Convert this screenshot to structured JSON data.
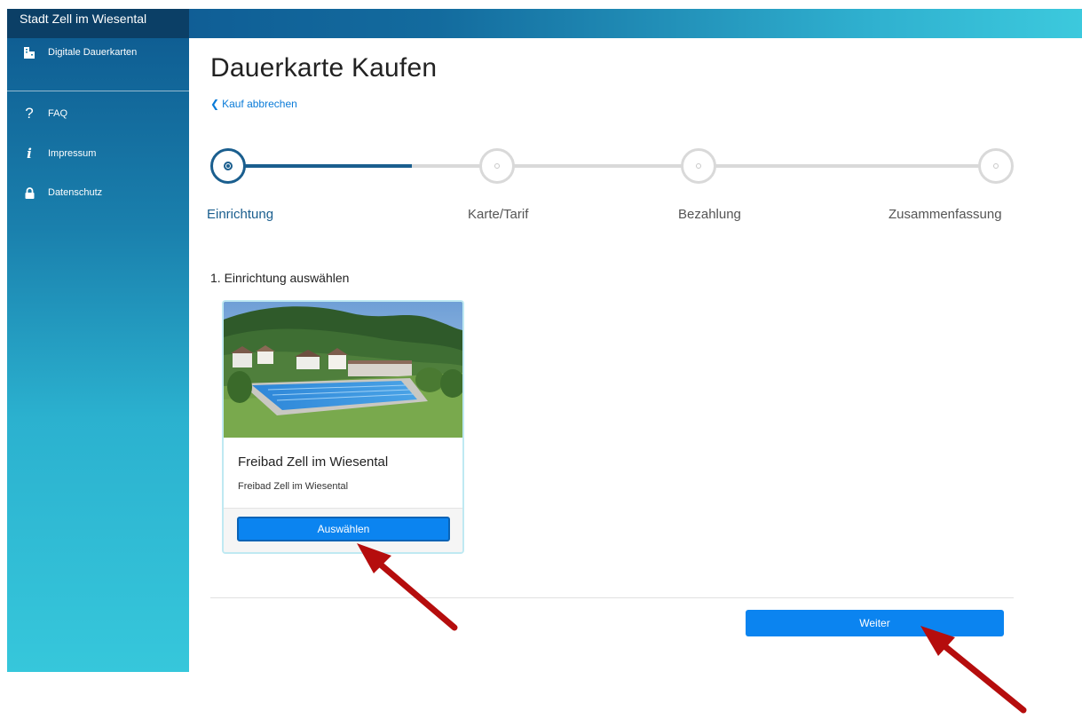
{
  "brand": "Stadt Zell im Wiesental",
  "sidebar": {
    "items": [
      {
        "label": "Digitale Dauerkarten",
        "icon": "card-icon"
      },
      {
        "label": "FAQ",
        "icon": "question-icon"
      },
      {
        "label": "Impressum",
        "icon": "info-icon"
      },
      {
        "label": "Datenschutz",
        "icon": "lock-icon"
      }
    ]
  },
  "main": {
    "title": "Dauerkarte Kaufen",
    "cancel_label": "Kauf abbrechen",
    "steps": [
      {
        "label": "Einrichtung",
        "active": true
      },
      {
        "label": "Karte/Tarif",
        "active": false
      },
      {
        "label": "Bezahlung",
        "active": false
      },
      {
        "label": "Zusammenfassung",
        "active": false
      }
    ],
    "section_title": "1. Einrichtung auswählen",
    "facility": {
      "title": "Freibad Zell im Wiesental",
      "subtitle": "Freibad Zell im Wiesental",
      "select_label": "Auswählen"
    },
    "next_label": "Weiter"
  },
  "colors": {
    "accent": "#0b84f0",
    "stepper_active": "#1a5e8e",
    "annotation_arrow": "#b50d0d"
  }
}
